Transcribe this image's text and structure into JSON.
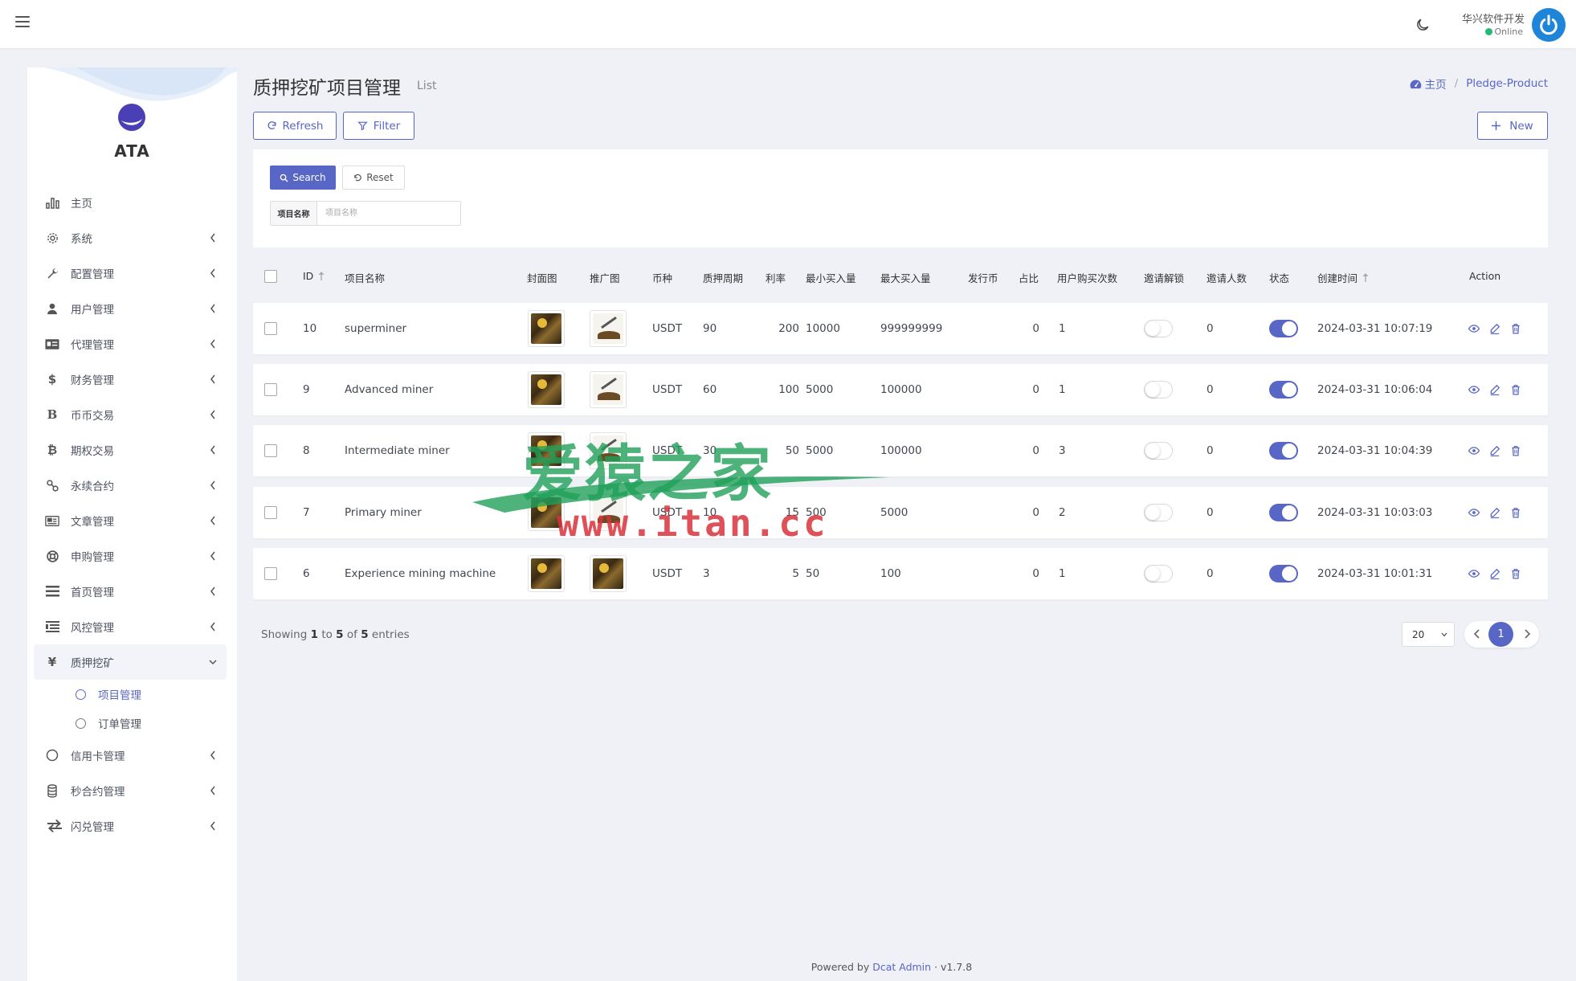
{
  "header": {
    "user_name": "华兴软件开发",
    "user_status": "Online"
  },
  "sidebar": {
    "brand": "ATA",
    "items": [
      {
        "label": "主页",
        "icon": "bar-chart-icon"
      },
      {
        "label": "系统",
        "icon": "gear-icon"
      },
      {
        "label": "配置管理",
        "icon": "wrench-icon"
      },
      {
        "label": "用户管理",
        "icon": "user-tie-icon"
      },
      {
        "label": "代理管理",
        "icon": "id-card-icon"
      },
      {
        "label": "财务管理",
        "icon": "dollar-icon"
      },
      {
        "label": "币币交易",
        "icon": "b-letter-icon"
      },
      {
        "label": "期权交易",
        "icon": "bitcoin-icon"
      },
      {
        "label": "永续合约",
        "icon": "link-icon"
      },
      {
        "label": "文章管理",
        "icon": "newspaper-icon"
      },
      {
        "label": "申购管理",
        "icon": "lifebuoy-icon"
      },
      {
        "label": "首页管理",
        "icon": "list-icon"
      },
      {
        "label": "风控管理",
        "icon": "indent-list-icon"
      },
      {
        "label": "质押挖矿",
        "icon": "yen-icon"
      },
      {
        "label": "信用卡管理",
        "icon": "circle-icon"
      },
      {
        "label": "秒合约管理",
        "icon": "coins-icon"
      },
      {
        "label": "闪兑管理",
        "icon": "exchange-icon"
      }
    ],
    "submenu": [
      {
        "label": "项目管理"
      },
      {
        "label": "订单管理"
      }
    ]
  },
  "page": {
    "title": "质押挖矿项目管理",
    "subtitle": "List",
    "breadcrumb_home": "主页",
    "breadcrumb_current": "Pledge-Product"
  },
  "toolbar": {
    "refresh": "Refresh",
    "filter": "Filter",
    "new": "New"
  },
  "filter": {
    "search": "Search",
    "reset": "Reset",
    "field_label": "项目名称",
    "field_placeholder": "项目名称",
    "field_value": ""
  },
  "table": {
    "columns": [
      "ID",
      "项目名称",
      "封面图",
      "推广图",
      "币种",
      "质押周期",
      "利率",
      "最小买入量",
      "最大买入量",
      "发行币",
      "占比",
      "用户购买次数",
      "邀请解锁",
      "邀请人数",
      "状态",
      "创建时间",
      "Action"
    ],
    "rows": [
      {
        "id": "10",
        "name": "superminer",
        "coin": "USDT",
        "period": "90",
        "rate": "200",
        "min": "10000",
        "max": "999999999",
        "issue": "",
        "ratio": "0",
        "buys": "1",
        "invite_unlock": false,
        "invites": "0",
        "status": true,
        "created": "2024-03-31 10:07:19",
        "promo": "pickaxe"
      },
      {
        "id": "9",
        "name": "Advanced miner",
        "coin": "USDT",
        "period": "60",
        "rate": "100",
        "min": "5000",
        "max": "100000",
        "issue": "",
        "ratio": "0",
        "buys": "1",
        "invite_unlock": false,
        "invites": "0",
        "status": true,
        "created": "2024-03-31 10:06:04",
        "promo": "pickaxe"
      },
      {
        "id": "8",
        "name": "Intermediate miner",
        "coin": "USDT",
        "period": "30",
        "rate": "50",
        "min": "5000",
        "max": "100000",
        "issue": "",
        "ratio": "0",
        "buys": "3",
        "invite_unlock": false,
        "invites": "0",
        "status": true,
        "created": "2024-03-31 10:04:39",
        "promo": "pickaxe"
      },
      {
        "id": "7",
        "name": "Primary miner",
        "coin": "USDT",
        "period": "10",
        "rate": "15",
        "min": "500",
        "max": "5000",
        "issue": "",
        "ratio": "0",
        "buys": "2",
        "invite_unlock": false,
        "invites": "0",
        "status": true,
        "created": "2024-03-31 10:03:03",
        "promo": "pickaxe"
      },
      {
        "id": "6",
        "name": "Experience mining machine",
        "coin": "USDT",
        "period": "3",
        "rate": "5",
        "min": "50",
        "max": "100",
        "issue": "",
        "ratio": "0",
        "buys": "1",
        "invite_unlock": false,
        "invites": "0",
        "status": true,
        "created": "2024-03-31 10:01:31",
        "promo": "cover"
      }
    ]
  },
  "pagination": {
    "showing_prefix": "Showing",
    "from": "1",
    "to_word": "to",
    "to": "5",
    "of_word": "of",
    "total": "5",
    "entries_word": "entries",
    "per_page": "20",
    "current_page": "1"
  },
  "footer": {
    "powered_by": "Powered by",
    "link": "Dcat Admin",
    "dot": "·",
    "version": "v1.7.8"
  },
  "watermark": {
    "cn": "爱猿之家",
    "url": "www.itan.cc"
  },
  "colors": {
    "accent": "#5866c6",
    "background": "#eff1f6",
    "online": "#21b978"
  }
}
